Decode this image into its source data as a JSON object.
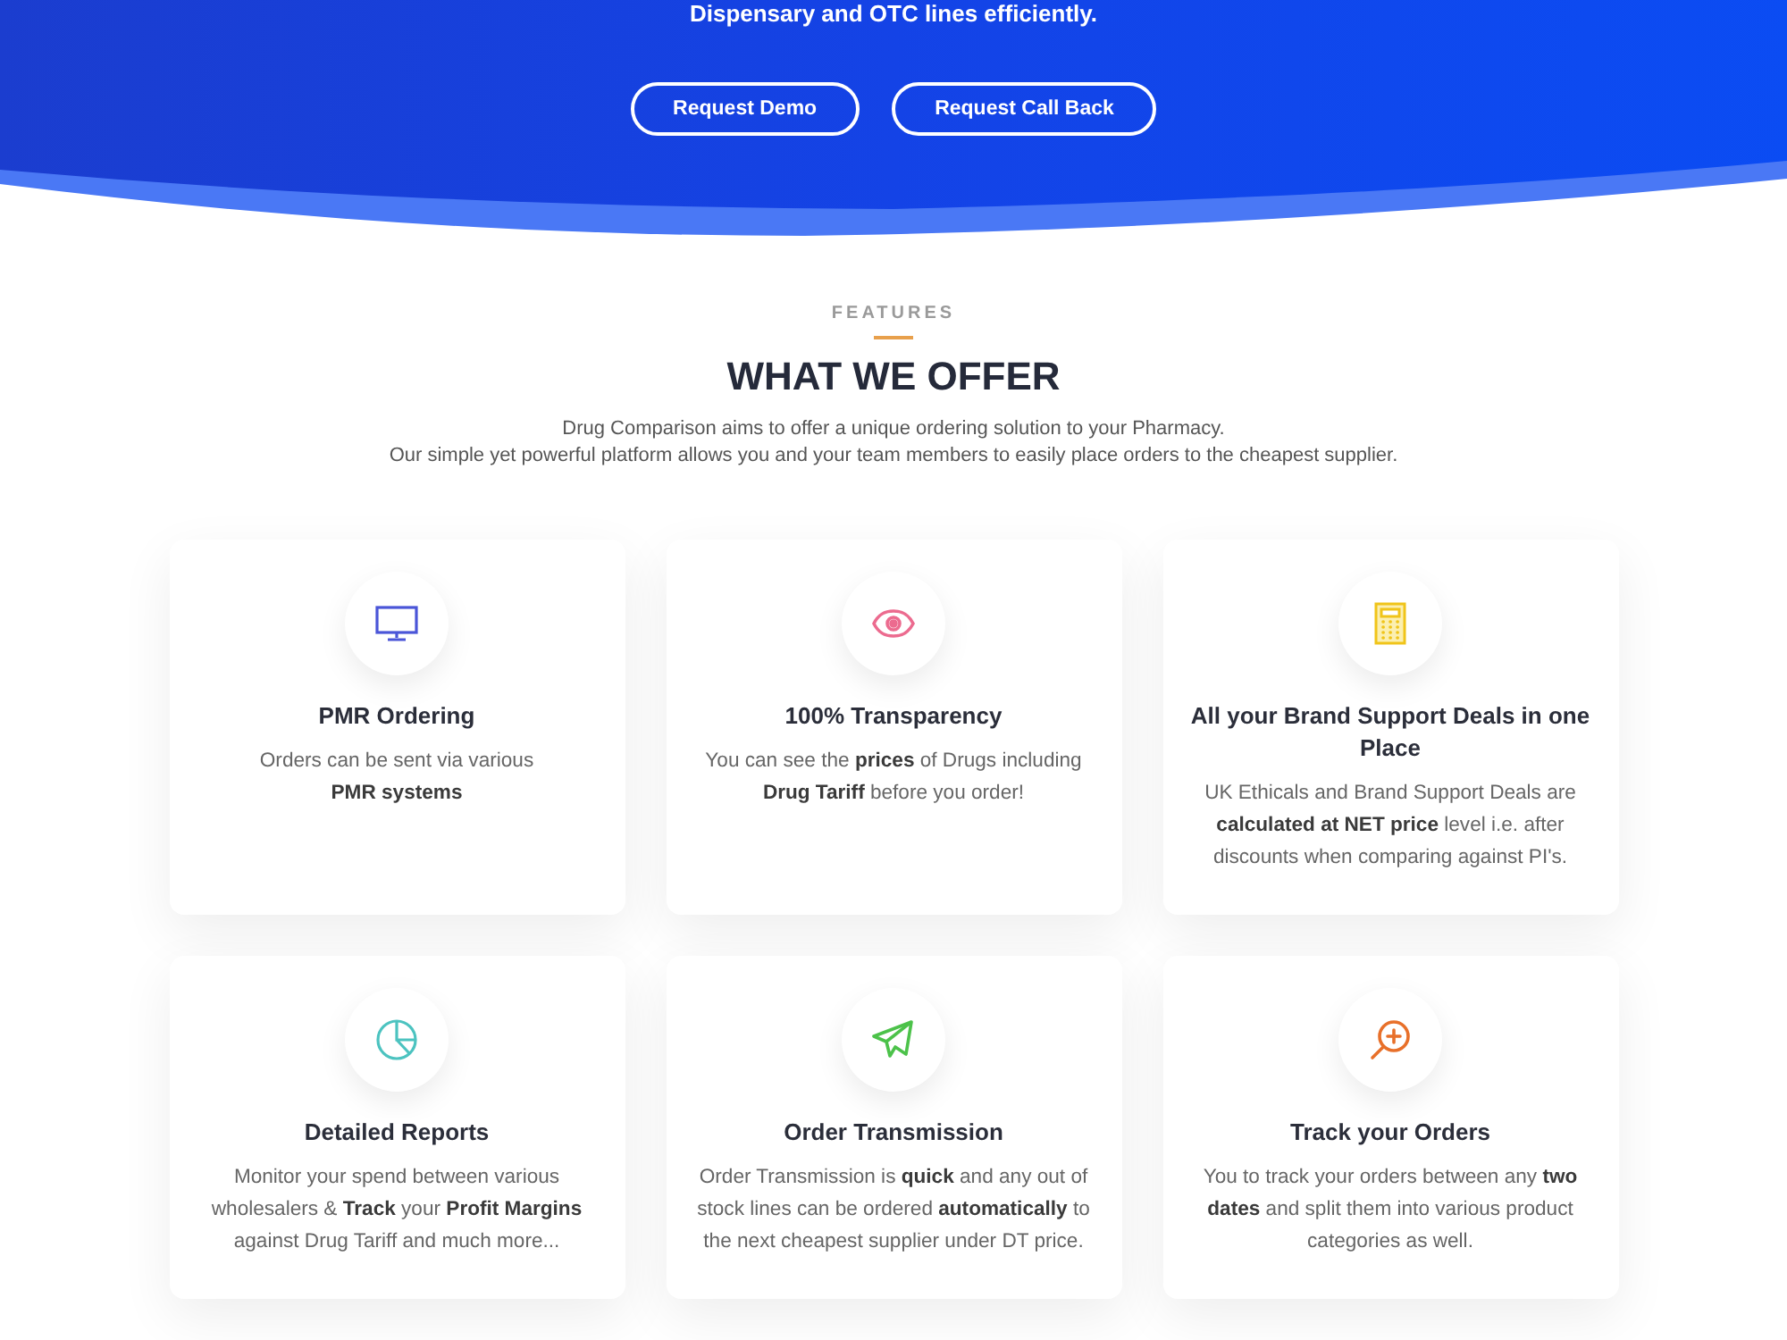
{
  "hero": {
    "tagline": "Dispensary and OTC lines efficiently.",
    "buttons": [
      {
        "label": "Request Demo"
      },
      {
        "label": "Request Call Back"
      }
    ]
  },
  "features_section": {
    "eyebrow": "FEATURES",
    "heading": "WHAT WE OFFER",
    "intro": "Drug Comparison aims to offer a unique ordering solution to your Pharmacy.\nOur simple yet powerful platform allows you and your team members to easily place orders to the cheapest supplier."
  },
  "features": [
    {
      "title": "PMR Ordering",
      "description": "Orders can be sent via various\n**PMR systems**",
      "color": "#4a55d8"
    },
    {
      "title": "100% Transparency",
      "description": "You can see the **prices** of Drugs including\n**Drug Tariff** before you order!",
      "color": "#ec6b8f"
    },
    {
      "title": "All your Brand Support Deals in one\nPlace",
      "description": "UK Ethicals and Brand Support Deals are\n**calculated at NET price** level i.e. after\ndiscounts when comparing against PI's.",
      "color": "#f0c419"
    },
    {
      "title": "Detailed Reports",
      "description": "Monitor your spend between various\nwholesalers & **Track** your **Profit Margins**\nagainst Drug Tariff and much more...",
      "color": "#4cc3c0"
    },
    {
      "title": "Order Transmission",
      "description": "Order Transmission is **quick** and any out of\nstock lines can be ordered **automatically** to\nthe next cheapest supplier under DT price.",
      "color": "#4cc24a"
    },
    {
      "title": "Track your Orders",
      "description": "You to track your orders between any **two**\n**dates** and split them into various product\ncategories as well.",
      "color": "#e8702a"
    }
  ]
}
